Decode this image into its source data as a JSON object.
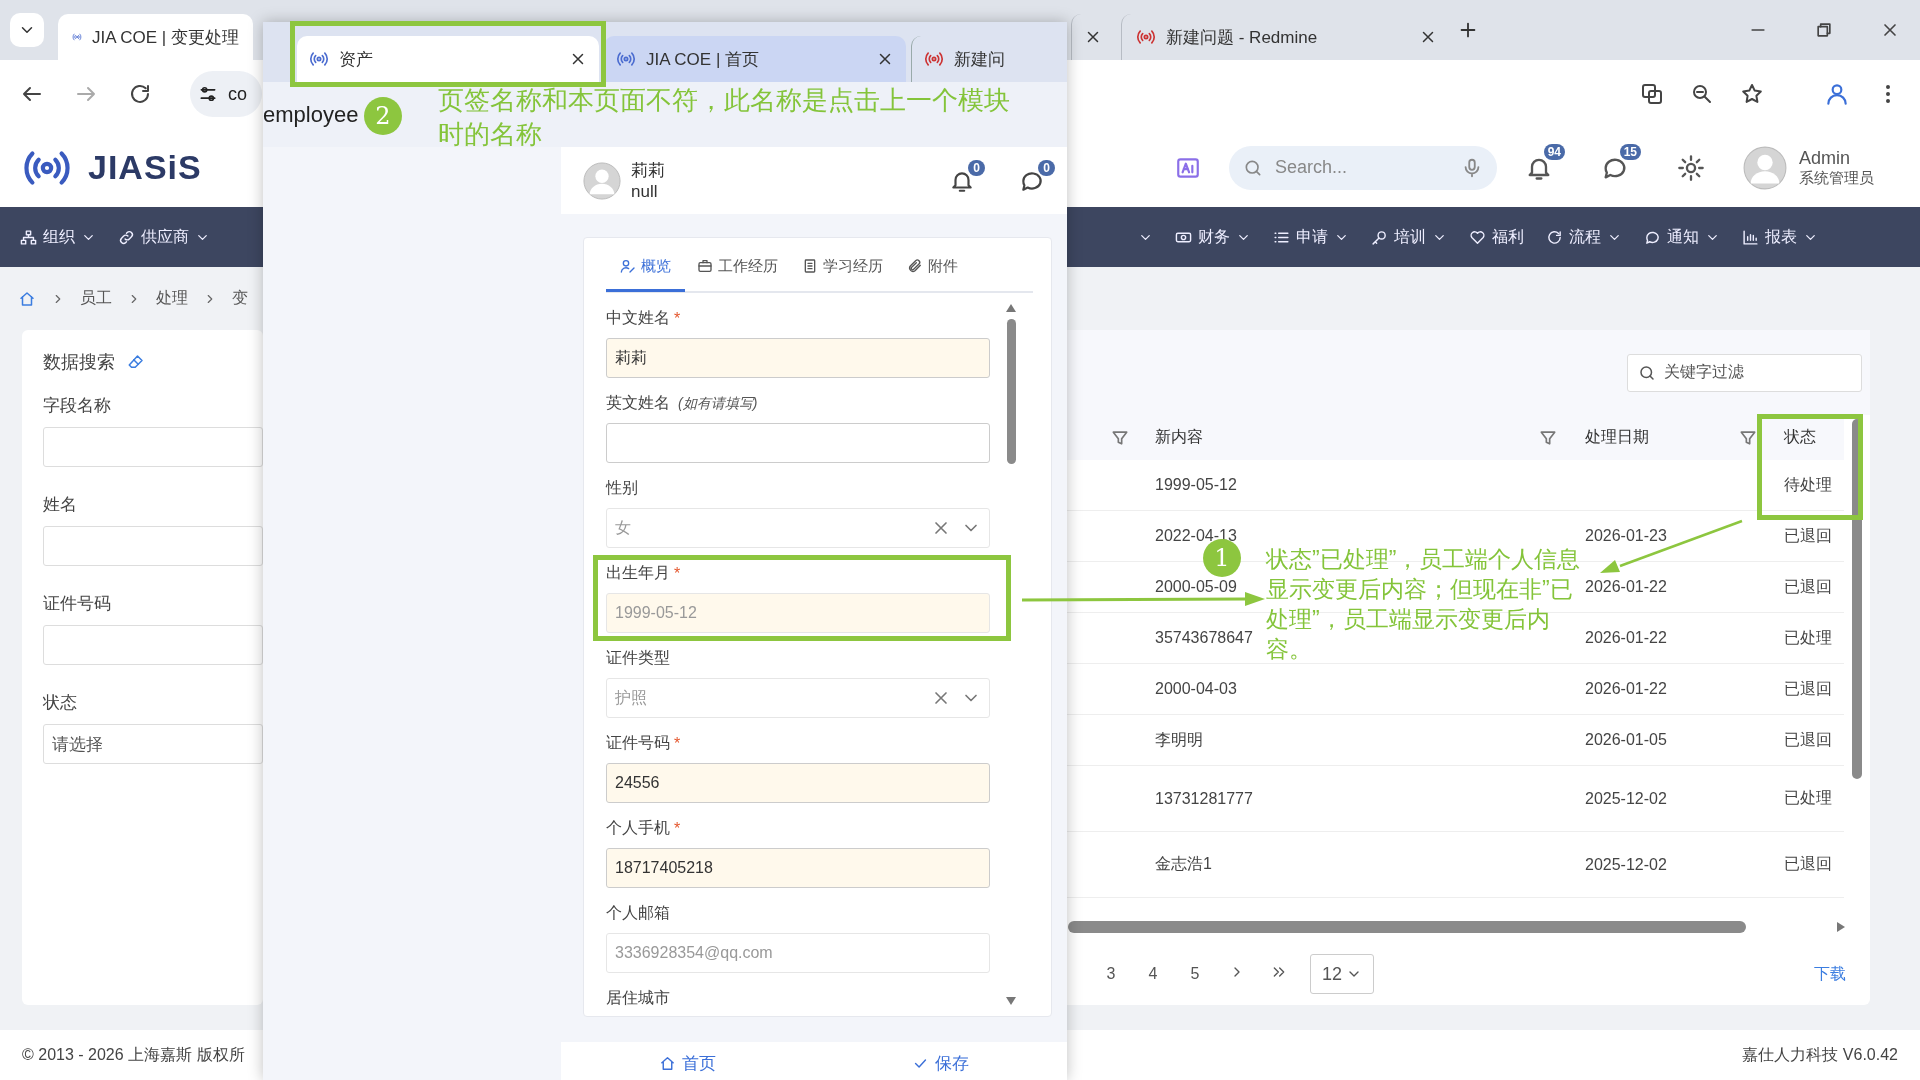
{
  "browser": {
    "tabs": [
      {
        "title": "JIA COE | 变更处理",
        "selected": true
      },
      {
        "selected": false
      },
      {
        "title": "新建问题 - Redmine",
        "selected": false
      }
    ],
    "url": "co"
  },
  "app": {
    "logo": "JIASiS",
    "search": {
      "placeholder": "Search..."
    },
    "notifications": "94",
    "messages": "15",
    "user": {
      "name": "Admin",
      "role": "系统管理员"
    },
    "nav": {
      "left": [
        "组织",
        "供应商"
      ],
      "right": [
        "财务",
        "申请",
        "培训",
        "福利",
        "流程",
        "通知",
        "报表"
      ]
    },
    "breadcrumb": [
      "员工",
      "处理",
      "变"
    ],
    "search_panel": {
      "title": "数据搜索",
      "fields": [
        {
          "label": "字段名称"
        },
        {
          "label": "姓名"
        },
        {
          "label": "证件号码"
        },
        {
          "label": "状态",
          "placeholder": "请选择"
        }
      ]
    },
    "table": {
      "filter": {
        "placeholder": "关键字过滤"
      },
      "columns": [
        "新内容",
        "处理日期",
        "状态"
      ],
      "rows": [
        {
          "new_content": "1999-05-12",
          "status": "待处理"
        },
        {
          "new_content": "2022-04-13",
          "processed_date": "2026-01-23",
          "status": "已退回"
        },
        {
          "new_content": "2000-05-09",
          "processed_date": "2026-01-22",
          "status": "已退回"
        },
        {
          "new_content": "35743678647",
          "processed_date": "2026-01-22",
          "status": "已处理"
        },
        {
          "new_content": "2000-04-03",
          "processed_date": "2026-01-22",
          "status": "已退回"
        },
        {
          "new_content": "李明明",
          "processed_date": "2026-01-05",
          "status": "已退回"
        },
        {
          "new_content": "13731281777",
          "processed_date": "2025-12-02",
          "status": "已处理"
        },
        {
          "new_content": "金志浩1",
          "processed_date": "2025-12-02",
          "status": "已退回"
        }
      ],
      "pages": [
        "3",
        "4",
        "5"
      ],
      "page_size": "12",
      "download": "下载"
    },
    "footer": {
      "copyright": "© 2013 - 2026 上海嘉斯 版权所",
      "version": "嘉仕人力科技 V6.0.42"
    }
  },
  "popup": {
    "tabs": [
      {
        "title": "资产",
        "selected": true
      },
      {
        "title": "JIA COE | 首页",
        "selected": false
      },
      {
        "title": "新建问",
        "selected": false
      }
    ],
    "address": "employee",
    "profile": {
      "name": "莉莉",
      "subtitle": "null",
      "notifications": "0",
      "messages": "0"
    },
    "sections": [
      {
        "label": "概览",
        "selected": true
      },
      {
        "label": "工作经历",
        "selected": false
      },
      {
        "label": "学习经历",
        "selected": false
      },
      {
        "label": "附件",
        "selected": false
      }
    ],
    "fields": [
      {
        "kind": "text",
        "label": "中文姓名",
        "required": true,
        "value": "莉莉",
        "disabled": false
      },
      {
        "kind": "text",
        "label": "英文姓名",
        "hint": "(如有请填写)",
        "required": false,
        "disabled": false
      },
      {
        "kind": "select",
        "label": "性别",
        "required": false,
        "value": "女",
        "disabled": true
      },
      {
        "kind": "text",
        "label": "出生年月",
        "required": true,
        "value": "1999-05-12",
        "disabled": true
      },
      {
        "kind": "select",
        "label": "证件类型",
        "required": false,
        "value": "护照",
        "disabled": true
      },
      {
        "kind": "text",
        "label": "证件号码",
        "required": true,
        "value": "24556",
        "disabled": false
      },
      {
        "kind": "text",
        "label": "个人手机",
        "required": true,
        "value": "18717405218",
        "disabled": false
      },
      {
        "kind": "text",
        "label": "个人邮箱",
        "required": false,
        "value": "3336928354@qq.com",
        "disabled": true
      }
    ],
    "next_label": "居住城市",
    "required_mark": "*",
    "bottom_bar": [
      "首页",
      "保存"
    ]
  },
  "notes": [
    {
      "number": "2",
      "text": "页签名称和本页面不符，此名称是点击上一个模块时的名称"
    },
    {
      "number": "1",
      "text": "状态”已处理”，员工端个人信息显示变更后内容；但现在非”已处理”，员工端显示变更后内容。"
    }
  ]
}
